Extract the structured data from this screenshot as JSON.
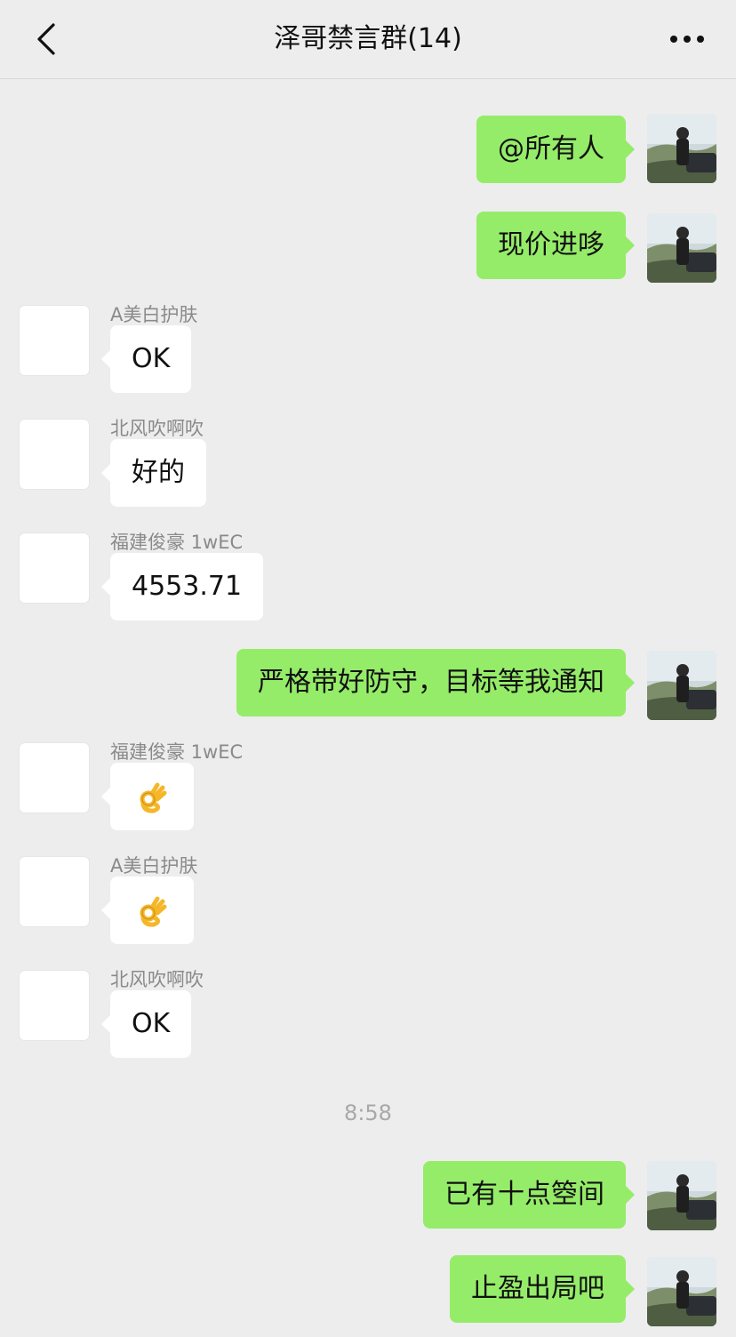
{
  "header": {
    "title": "泽哥禁言群(14)"
  },
  "icons": {
    "back": "chevron-left-icon",
    "more": "more-dots-icon",
    "ok_emoji": "ok-hand-emoji-icon"
  },
  "colors": {
    "background": "#ededed",
    "outgoing_bubble": "#95ec69",
    "incoming_bubble": "#ffffff",
    "time_text": "#a8a8a8",
    "sender_text": "#8a8a8a"
  },
  "messages": [
    {
      "direction": "out",
      "text": "@所有人"
    },
    {
      "direction": "out",
      "text": "现价进哆"
    },
    {
      "direction": "in",
      "sender": "A美白护肤",
      "text": "OK"
    },
    {
      "direction": "in",
      "sender": "北风吹啊吹",
      "text": "好的"
    },
    {
      "direction": "in",
      "sender": "福建俊豪 1wEC",
      "text": "4553.71"
    },
    {
      "direction": "out",
      "text": "严格带好防守，目标等我通知"
    },
    {
      "direction": "in",
      "sender": "福建俊豪 1wEC",
      "emoji": "👌"
    },
    {
      "direction": "in",
      "sender": "A美白护肤",
      "emoji": "👌"
    },
    {
      "direction": "in",
      "sender": "北风吹啊吹",
      "text": "OK"
    },
    {
      "direction": "out",
      "text": "已有十点箜间"
    },
    {
      "direction": "out",
      "text": "止盈出局吧"
    }
  ],
  "timestamps": {
    "t2": "8:58"
  }
}
